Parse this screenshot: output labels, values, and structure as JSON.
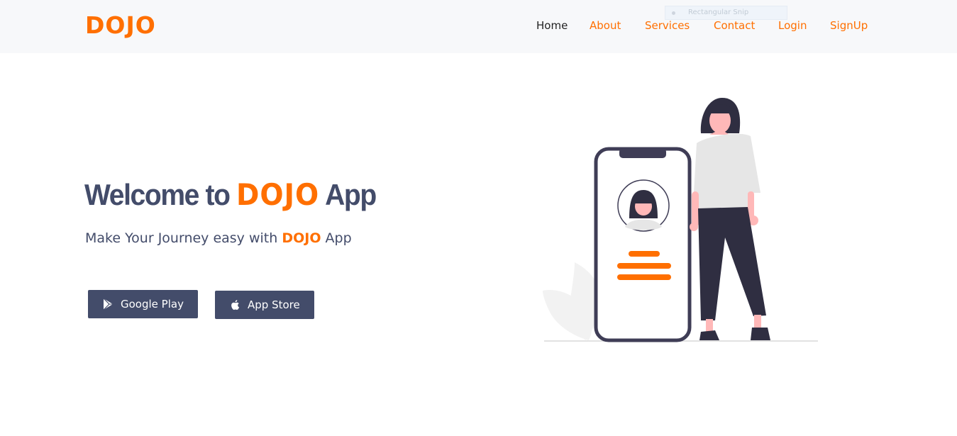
{
  "brand": {
    "name": "DOJO",
    "color": "#ff6f00"
  },
  "nav": {
    "items": [
      {
        "label": "Home",
        "active": true
      },
      {
        "label": "About",
        "active": false
      },
      {
        "label": "Services",
        "active": false
      },
      {
        "label": "Contact",
        "active": false
      },
      {
        "label": "Login",
        "active": false
      },
      {
        "label": "SignUp",
        "active": false
      }
    ]
  },
  "snip_tooltip": {
    "text": "Rectangular Snip"
  },
  "hero": {
    "title_prefix": "Welcome to",
    "title_brand": "DOJO",
    "title_suffix": "App",
    "subtitle_prefix": "Make Your Journey easy with",
    "subtitle_brand": "DOJO",
    "subtitle_suffix": "App"
  },
  "buttons": {
    "google_play": {
      "label": "Google Play",
      "icon": "play-store-icon"
    },
    "app_store": {
      "label": "App Store",
      "icon": "apple-icon"
    }
  },
  "colors": {
    "accent": "#ff6f00",
    "primary": "#434c6a",
    "navbar_bg": "#f7f8fa",
    "active_nav": "#222222"
  },
  "illustration": {
    "name": "woman-with-phone-illustration"
  }
}
